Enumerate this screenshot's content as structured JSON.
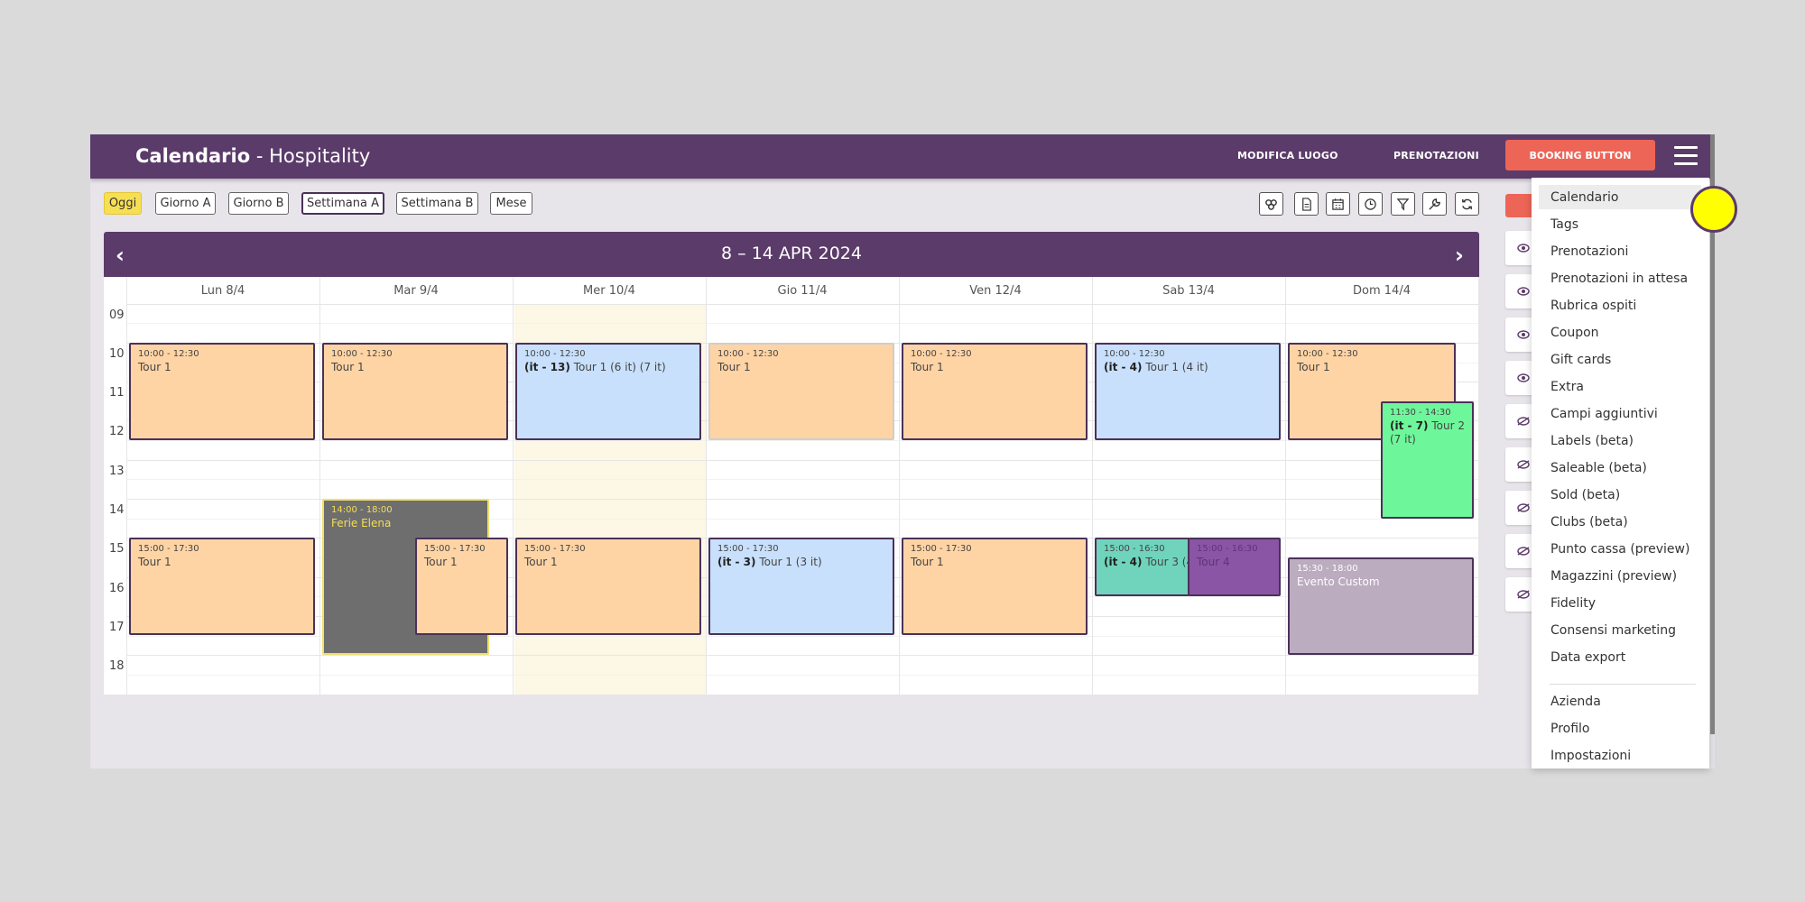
{
  "header": {
    "title_bold": "Calendario",
    "title_rest": " - Hospitality",
    "nav": [
      "MODIFICA LUOGO",
      "PRENOTAZIONI"
    ],
    "booking_button": "BOOKING BUTTON",
    "menu_icon": "hamburger-icon"
  },
  "toolbar": {
    "views": [
      "Oggi",
      "Giorno A",
      "Giorno B",
      "Settimana A",
      "Settimana B",
      "Mese"
    ],
    "active_view": "Settimana A",
    "icons": [
      "group-icon",
      "document-icon",
      "calendar-icon",
      "clock-icon",
      "filter-icon",
      "wrench-icon",
      "refresh-icon"
    ]
  },
  "calendar": {
    "range": "8 – 14 APR 2024",
    "prev": "‹",
    "next": "›",
    "days": [
      "Lun 8/4",
      "Mar 9/4",
      "Mer 10/4",
      "Gio 11/4",
      "Ven 12/4",
      "Sab 13/4",
      "Dom 14/4"
    ],
    "today": "Mer 10/4",
    "hours": [
      "09",
      "10",
      "11",
      "12",
      "13",
      "14",
      "15",
      "16",
      "17",
      "18"
    ],
    "events": [
      {
        "time": "10:00 - 12:30",
        "tag": "",
        "title": "Tour 1",
        "color": "#ffd4a5"
      },
      {
        "time": "10:00 - 12:30",
        "tag": "",
        "title": "Tour 1",
        "color": "#ffd4a5"
      },
      {
        "time": "10:00 - 12:30",
        "tag": "(it - 13)",
        "title": "Tour 1  (6 it)  (7 it)",
        "color": "#c8e0fb"
      },
      {
        "time": "10:00 - 12:30",
        "tag": "",
        "title": "Tour 1",
        "color": "#ffd4a5"
      },
      {
        "time": "10:00 - 12:30",
        "tag": "",
        "title": "Tour 1",
        "color": "#ffd4a5"
      },
      {
        "time": "10:00 - 12:30",
        "tag": "(it - 4)",
        "title": "Tour 1  (4 it)",
        "color": "#c8e0fb"
      },
      {
        "time": "10:00 - 12:30",
        "tag": "",
        "title": "Tour 1",
        "color": "#ffd4a5"
      },
      {
        "time": "11:30 - 14:30",
        "tag": "(it - 7)",
        "title": "Tour 2  (7 it)",
        "color": "#6ef79a"
      },
      {
        "time": "14:00 - 18:00",
        "tag": "",
        "title": "Ferie Elena",
        "color": "#6e6e6e"
      },
      {
        "time": "15:00 - 17:30",
        "tag": "",
        "title": "Tour 1",
        "color": "#ffd4a5"
      },
      {
        "time": "15:00 - 17:30",
        "tag": "",
        "title": "Tour 1",
        "color": "#ffd4a5"
      },
      {
        "time": "15:00 - 17:30",
        "tag": "",
        "title": "Tour 1",
        "color": "#ffd4a5"
      },
      {
        "time": "15:00 - 17:30",
        "tag": "(it - 3)",
        "title": "Tour 1  (3 it)",
        "color": "#c8e0fb"
      },
      {
        "time": "15:00 - 17:30",
        "tag": "",
        "title": "Tour 1",
        "color": "#ffd4a5"
      },
      {
        "time": "15:00 - 16:30",
        "tag": "(it - 4)",
        "title": "Tour 3  (4",
        "color": "#6fd4bb"
      },
      {
        "time": "15:00 - 16:30",
        "tag": "",
        "title": "Tour 4",
        "color": "#8a55a4"
      },
      {
        "time": "15:30 - 18:00",
        "tag": "",
        "title": "Evento Custom",
        "color": "#bbacc0"
      }
    ]
  },
  "side_panel": {
    "icons": [
      "eye-icon",
      "eye-icon",
      "eye-icon",
      "eye-icon",
      "eye-off-icon",
      "eye-off-icon",
      "eye-off-icon",
      "eye-off-icon",
      "eye-off-icon"
    ]
  },
  "menu": {
    "items": [
      "Calendario",
      "Tags",
      "Prenotazioni",
      "Prenotazioni in attesa",
      "Rubrica ospiti",
      "Coupon",
      "Gift cards",
      "Extra",
      "Campi aggiuntivi",
      "Labels (beta)",
      "Saleable (beta)",
      "Sold (beta)",
      "Clubs (beta)",
      "Punto cassa (preview)",
      "Magazzini (preview)",
      "Fidelity",
      "Consensi marketing",
      "Data export"
    ],
    "items2": [
      "Azienda",
      "Profilo",
      "Impostazioni"
    ],
    "selected": "Calendario"
  },
  "colors": {
    "brand": "#5b3b6a",
    "accent": "#ec6557",
    "today": "#f6df52"
  }
}
